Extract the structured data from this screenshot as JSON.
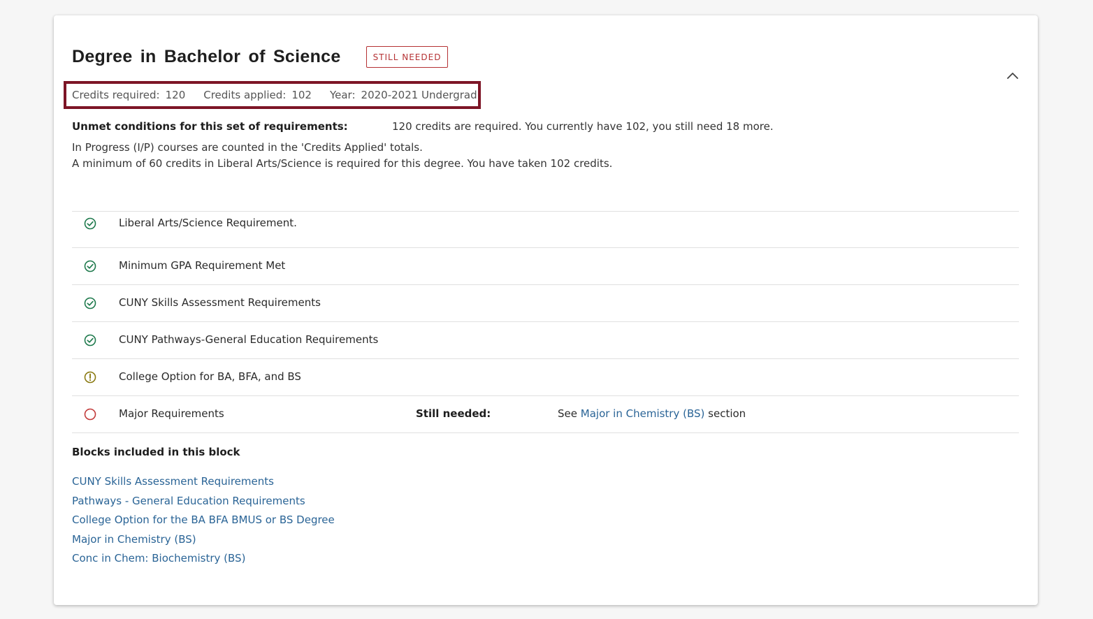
{
  "block": {
    "title": "Degree in Bachelor of Science",
    "status_badge": "STILL NEEDED",
    "collapse_icon": "chevron-up-icon"
  },
  "summary": {
    "credits_required_label": "Credits required:",
    "credits_required_value": "120",
    "credits_applied_label": "Credits applied:",
    "credits_applied_value": "102",
    "year_label": "Year:",
    "year_value": "2020-2021 Undergrad"
  },
  "unmet": {
    "label": "Unmet conditions for this set of requirements:",
    "text": "120 credits are required. You currently have 102, you still need 18 more."
  },
  "notes": [
    "In Progress (I/P) courses are counted in the 'Credits Applied' totals.",
    "A minimum of 60 credits in Liberal Arts/Science is required for this degree. You have taken 102 credits."
  ],
  "requirements": [
    {
      "label": "Liberal Arts/Science Requirement.",
      "status": "complete",
      "icon": "check-circle-icon"
    },
    {
      "label": "Minimum GPA Requirement Met",
      "status": "complete",
      "icon": "check-circle-icon"
    },
    {
      "label": "CUNY Skills Assessment Requirements",
      "status": "complete",
      "icon": "check-circle-icon"
    },
    {
      "label": "CUNY Pathways-General Education Requirements",
      "status": "complete",
      "icon": "check-circle-icon"
    },
    {
      "label": "College Option for BA, BFA, and BS",
      "status": "in-progress",
      "icon": "exclamation-circle-icon"
    },
    {
      "label": "Major Requirements",
      "status": "not-complete",
      "icon": "empty-circle-icon",
      "still_needed_label": "Still needed:",
      "see_prefix": "See",
      "see_link": "Major in Chemistry (BS)",
      "see_suffix": "section"
    }
  ],
  "blocks_included": {
    "heading": "Blocks included in this block",
    "links": [
      "CUNY Skills Assessment Requirements",
      "Pathways - General Education Requirements",
      "College Option for the BA BFA BMUS or BS Degree",
      "Major in Chemistry (BS)",
      "Conc in Chem: Biochemistry (BS)"
    ]
  },
  "colors": {
    "complete": "#1f7a4d",
    "in_progress": "#8a7a12",
    "not_complete": "#c23b3b",
    "badge": "#b53234",
    "highlight_border": "#7d1526",
    "link": "#2a6496"
  }
}
